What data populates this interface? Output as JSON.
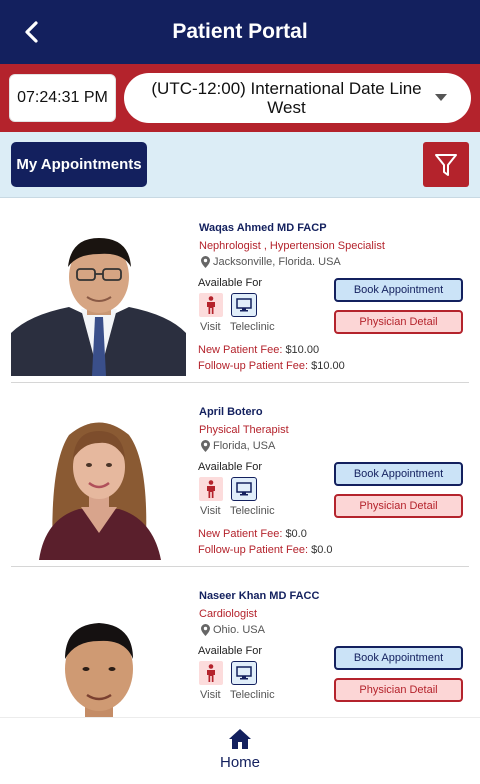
{
  "header": {
    "title": "Patient Portal",
    "back_icon": "back-arrow-icon"
  },
  "timezone_bar": {
    "clock": "07:24:31 PM",
    "timezone": "(UTC-12:00) International Date Line West"
  },
  "toolbar": {
    "my_appointments_label": "My Appointments",
    "filter_icon": "filter-icon"
  },
  "labels": {
    "available_for": "Available For",
    "visit": "Visit",
    "teleclinic": "Teleclinic",
    "new_fee": "New Patient Fee:",
    "followup_fee": "Follow-up Patient Fee:",
    "book": "Book Appointment",
    "detail": "Physician Detail"
  },
  "doctors": [
    {
      "name": "Waqas Ahmed MD FACP",
      "specialty": "Nephrologist , Hypertension Specialist",
      "location": "Jacksonville, Florida. USA",
      "new_fee": "$10.00",
      "followup_fee": "$10.00"
    },
    {
      "name": "April Botero",
      "specialty": "Physical Therapist",
      "location": "Florida, USA",
      "new_fee": "$0.0",
      "followup_fee": "$0.0"
    },
    {
      "name": "Naseer Khan MD FACC",
      "specialty": "Cardiologist",
      "location": "Ohio. USA",
      "new_fee": "",
      "followup_fee": ""
    }
  ],
  "bottom_nav": {
    "home_label": "Home",
    "home_icon": "home-icon"
  },
  "colors": {
    "navy": "#13205e",
    "red": "#b4232c",
    "light_blue": "#dcedf6"
  }
}
